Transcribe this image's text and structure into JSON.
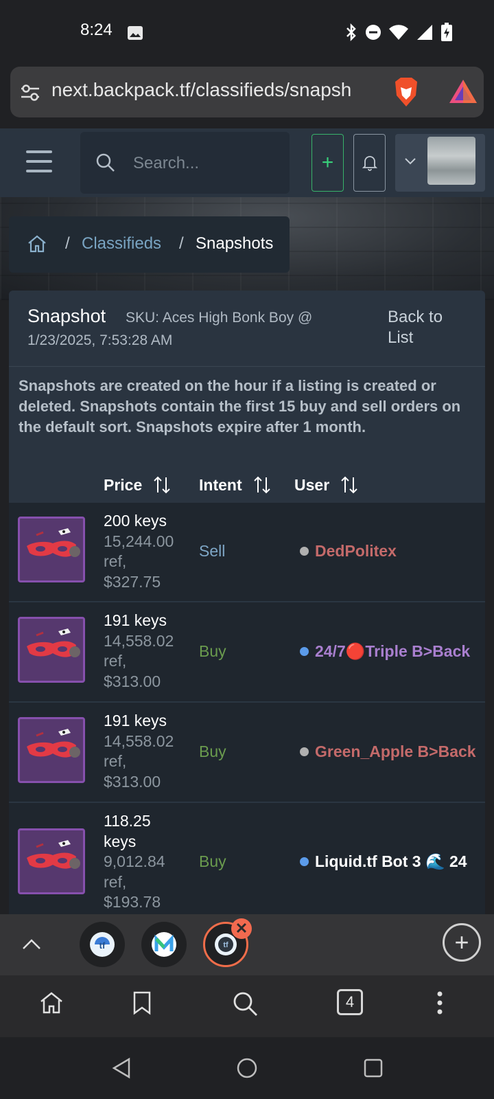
{
  "status_bar": {
    "time": "8:24"
  },
  "browser": {
    "url": "next.backpack.tf/classifieds/snapsh",
    "tab_count": "4"
  },
  "header": {
    "search_placeholder": "Search...",
    "add_label": "+"
  },
  "breadcrumb": {
    "sep": "/",
    "link": "Classifieds",
    "current": "Snapshots"
  },
  "snapshot": {
    "title": "Snapshot",
    "sku": "SKU: Aces High Bonk Boy @",
    "date": "1/23/2025, 7:53:28 AM",
    "back_label": "Back to List",
    "note": "Snapshots are created on the hour if a listing is created or deleted. Snapshots contain the first 15 buy and sell orders on the default sort. Snapshots expire after 1 month.",
    "columns": {
      "price": "Price",
      "intent": "Intent",
      "user": "User"
    },
    "rows": [
      {
        "keys": "200 keys",
        "ref": "15,244.00",
        "ref_unit": "ref,",
        "usd": "$327.75",
        "intent": "Sell",
        "user": "DedPolitex"
      },
      {
        "keys": "191 keys",
        "ref": "14,558.02",
        "ref_unit": "ref,",
        "usd": "$313.00",
        "intent": "Buy",
        "user": "24/7🔴Triple B>Back"
      },
      {
        "keys": "191 keys",
        "ref": "14,558.02",
        "ref_unit": "ref,",
        "usd": "$313.00",
        "intent": "Buy",
        "user": "Green_Apple B>Back"
      },
      {
        "keys": "118.25",
        "keys2": "keys",
        "ref": "9,012.84",
        "ref_unit": "ref,",
        "usd": "$193.78",
        "intent": "Buy",
        "user": "Liquid.tf Bot 3 🌊 24"
      }
    ]
  },
  "colors": {
    "sell": "#7ea6c6",
    "buy": "#6a9b4e",
    "user_red": "#c46a6a",
    "user_purple": "#a97fcf",
    "user_white": "#ffffff",
    "dot_gray": "#b0b0b0",
    "dot_blue": "#5b9bea"
  }
}
